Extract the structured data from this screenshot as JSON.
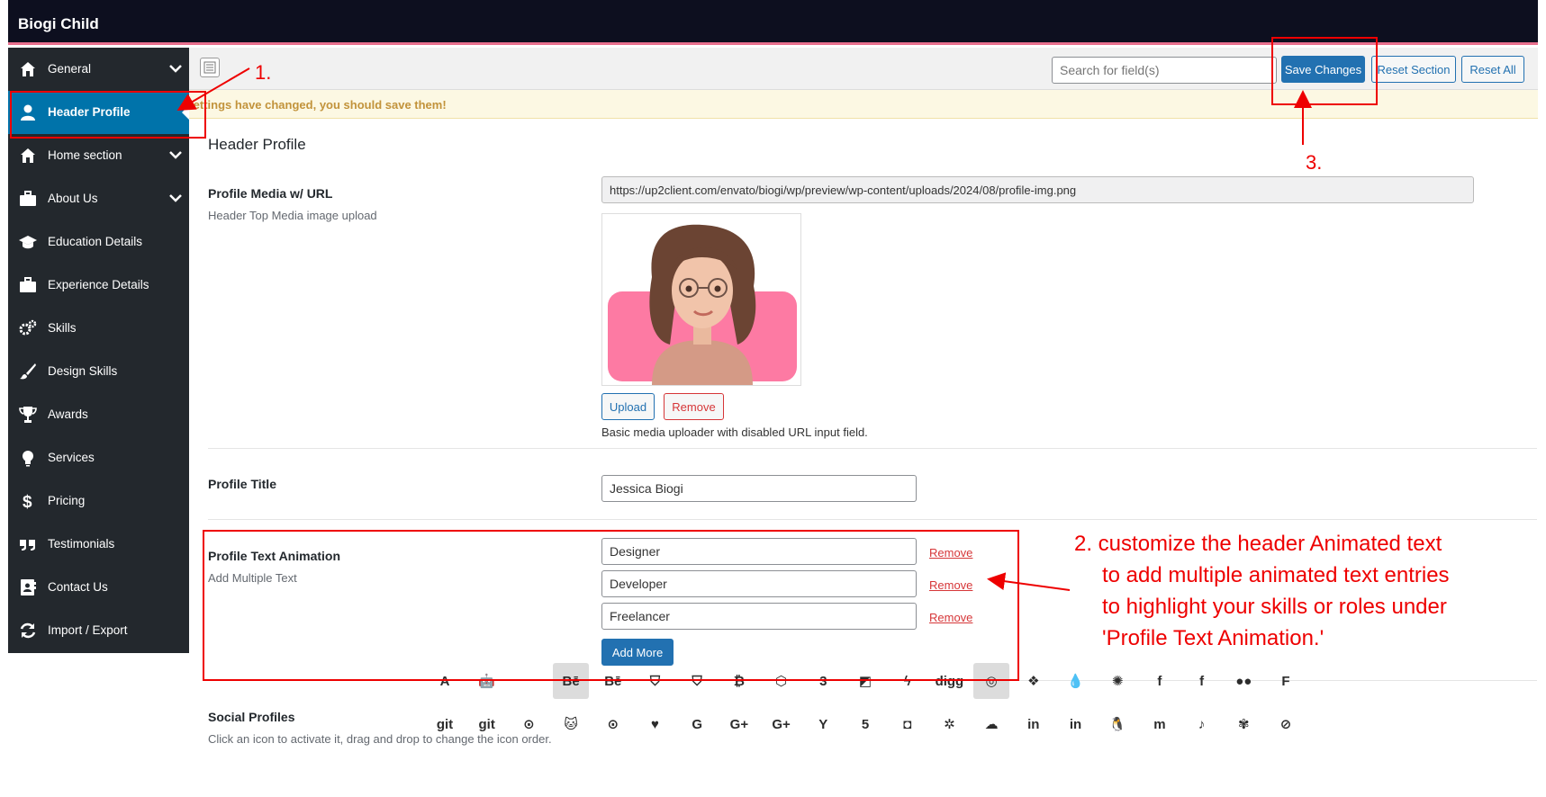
{
  "app": {
    "title": "Biogi Child"
  },
  "sidebar": {
    "items": [
      {
        "label": "General",
        "icon": "home-icon",
        "has_children": true,
        "active": false
      },
      {
        "label": "Header Profile",
        "icon": "user-icon",
        "has_children": false,
        "active": true
      },
      {
        "label": "Home section",
        "icon": "home-icon",
        "has_children": true,
        "active": false
      },
      {
        "label": "About Us",
        "icon": "briefcase-icon",
        "has_children": true,
        "active": false
      },
      {
        "label": "Education Details",
        "icon": "graduation-cap-icon",
        "has_children": false,
        "active": false
      },
      {
        "label": "Experience Details",
        "icon": "briefcase-icon",
        "has_children": false,
        "active": false
      },
      {
        "label": "Skills",
        "icon": "cogs-icon",
        "has_children": false,
        "active": false
      },
      {
        "label": "Design Skills",
        "icon": "paint-brush-icon",
        "has_children": false,
        "active": false
      },
      {
        "label": "Awards",
        "icon": "trophy-icon",
        "has_children": false,
        "active": false
      },
      {
        "label": "Services",
        "icon": "lightbulb-icon",
        "has_children": false,
        "active": false
      },
      {
        "label": "Pricing",
        "icon": "dollar-icon",
        "has_children": false,
        "active": false
      },
      {
        "label": "Testimonials",
        "icon": "quote-icon",
        "has_children": false,
        "active": false
      },
      {
        "label": "Contact Us",
        "icon": "address-card-icon",
        "has_children": false,
        "active": false
      },
      {
        "label": "Import / Export",
        "icon": "refresh-icon",
        "has_children": false,
        "active": false
      }
    ]
  },
  "toolbar": {
    "search_placeholder": "Search for field(s)",
    "save_label": "Save Changes",
    "reset_section_label": "Reset Section",
    "reset_all_label": "Reset All"
  },
  "notice": {
    "text": "Settings have changed, you should save them!"
  },
  "section": {
    "title": "Header Profile"
  },
  "fields": {
    "profile_media": {
      "label": "Profile Media w/ URL",
      "description": "Header Top Media image upload",
      "url": "https://up2client.com/envato/biogi/wp/preview/wp-content/uploads/2024/08/profile-img.png",
      "upload_label": "Upload",
      "remove_label": "Remove",
      "help": "Basic media uploader with disabled URL input field."
    },
    "profile_title": {
      "label": "Profile Title",
      "value": "Jessica Biogi"
    },
    "profile_text_animation": {
      "label": "Profile Text Animation",
      "description": "Add Multiple Text",
      "entries": [
        "Designer",
        "Developer",
        "Freelancer"
      ],
      "remove_label": "Remove",
      "add_more_label": "Add More"
    },
    "social_profiles": {
      "label": "Social Profiles",
      "description": "Click an icon to activate it, drag and drop to change the icon order.",
      "icons": [
        {
          "name": "app-store-icon",
          "glyph": "A",
          "active": false
        },
        {
          "name": "android-icon",
          "glyph": "🤖",
          "active": false
        },
        {
          "name": "apple-icon",
          "glyph": "",
          "active": false
        },
        {
          "name": "behance-icon",
          "glyph": "Bē",
          "active": true
        },
        {
          "name": "behance-square-icon",
          "glyph": "Bē",
          "active": false
        },
        {
          "name": "bitbucket-icon",
          "glyph": "⛉",
          "active": false
        },
        {
          "name": "bitbucket-square-icon",
          "glyph": "⛉",
          "active": false
        },
        {
          "name": "bitcoin-icon",
          "glyph": "₿",
          "active": false
        },
        {
          "name": "codepen-icon",
          "glyph": "⬡",
          "active": false
        },
        {
          "name": "css3-icon",
          "glyph": "3",
          "active": false
        },
        {
          "name": "delicious-icon",
          "glyph": "◩",
          "active": false
        },
        {
          "name": "deviantart-icon",
          "glyph": "ϟ",
          "active": false
        },
        {
          "name": "digg-icon",
          "glyph": "digg",
          "active": false
        },
        {
          "name": "dribbble-icon",
          "glyph": "◎",
          "active": true
        },
        {
          "name": "dropbox-icon",
          "glyph": "❖",
          "active": false
        },
        {
          "name": "drupal-icon",
          "glyph": "💧",
          "active": false
        },
        {
          "name": "empire-icon",
          "glyph": "✺",
          "active": false
        },
        {
          "name": "facebook-icon",
          "glyph": "f",
          "active": false
        },
        {
          "name": "facebook-square-icon",
          "glyph": "f",
          "active": false
        },
        {
          "name": "flickr-icon",
          "glyph": "●●",
          "active": false
        },
        {
          "name": "foursquare-icon",
          "glyph": "F",
          "active": false
        },
        {
          "name": "git-icon",
          "glyph": "git",
          "active": false
        },
        {
          "name": "git-square-icon",
          "glyph": "git",
          "active": false
        },
        {
          "name": "github-icon",
          "glyph": "⊙",
          "active": false
        },
        {
          "name": "github-alt-icon",
          "glyph": "🐱",
          "active": false
        },
        {
          "name": "github-square-icon",
          "glyph": "⊙",
          "active": false
        },
        {
          "name": "gratipay-icon",
          "glyph": "♥",
          "active": false
        },
        {
          "name": "google-icon",
          "glyph": "G",
          "active": false
        },
        {
          "name": "google-plus-icon",
          "glyph": "G+",
          "active": false
        },
        {
          "name": "google-plus-square-icon",
          "glyph": "G+",
          "active": false
        },
        {
          "name": "hacker-news-icon",
          "glyph": "Y",
          "active": false
        },
        {
          "name": "html5-icon",
          "glyph": "5",
          "active": false
        },
        {
          "name": "instagram-icon",
          "glyph": "◘",
          "active": false
        },
        {
          "name": "joomla-icon",
          "glyph": "✲",
          "active": false
        },
        {
          "name": "jsfiddle-icon",
          "glyph": "☁",
          "active": false
        },
        {
          "name": "linkedin-icon",
          "glyph": "in",
          "active": false
        },
        {
          "name": "linkedin-square-icon",
          "glyph": "in",
          "active": false
        },
        {
          "name": "linux-icon",
          "glyph": "🐧",
          "active": false
        },
        {
          "name": "medium-icon",
          "glyph": "m",
          "active": false
        },
        {
          "name": "tiktok-icon",
          "glyph": "♪",
          "active": false
        },
        {
          "name": "pied-piper-icon",
          "glyph": "✾",
          "active": false
        },
        {
          "name": "safari-icon",
          "glyph": "⊘",
          "active": false
        }
      ]
    }
  },
  "annotations": {
    "step1": "1.",
    "step2_lines": [
      "2. customize the header Animated text",
      "to add multiple animated text entries",
      "to highlight your skills or roles under",
      "'Profile Text Animation.'"
    ],
    "step3": "3."
  },
  "colors": {
    "topbar": "#0d0f1f",
    "topbar_accent": "#e8708e",
    "sidebar": "#23282d",
    "active": "#0073aa",
    "primary": "#2271b1",
    "annotation": "#ee0000"
  }
}
